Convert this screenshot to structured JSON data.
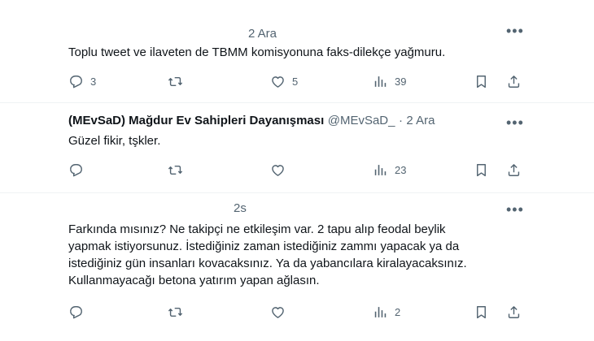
{
  "tweets": [
    {
      "time": "2 Ara",
      "text": "Toplu tweet ve ilaveten de TBMM komisyonuna faks-dilekçe yağmuru.",
      "replies": "3",
      "retweets": "",
      "likes": "5",
      "views": "39"
    },
    {
      "author": "(MEvSaD) Mağdur Ev Sahipleri Dayanışması",
      "handle": "@MEvSaD_",
      "separator": "·",
      "time": "2 Ara",
      "text": "Güzel fikir, tşkler.",
      "replies": "",
      "retweets": "",
      "likes": "",
      "views": "23"
    },
    {
      "time": "2s",
      "text_lines": [
        "Farkında mısınız? Ne takipçi ne etkileşim var. 2 tapu alıp feodal beylik",
        "yapmak istiyorsunuz. İstediğiniz zaman istediğiniz zammı yapacak ya da",
        "istediğiniz gün insanları kovacaksınız. Ya da yabancılara kiralayacaksınız.",
        "Kullanmayacağı betona yatırım yapan ağlasın."
      ],
      "replies": "",
      "retweets": "",
      "likes": "",
      "views": "2"
    }
  ],
  "more_label": "•••",
  "icons": {
    "reply": "reply-icon",
    "retweet": "retweet-icon",
    "like": "heart-icon",
    "views": "views-icon",
    "bookmark": "bookmark-icon",
    "share": "share-icon"
  },
  "colors": {
    "text": "#0f1419",
    "secondary": "#536471",
    "divider": "#eff3f4"
  }
}
